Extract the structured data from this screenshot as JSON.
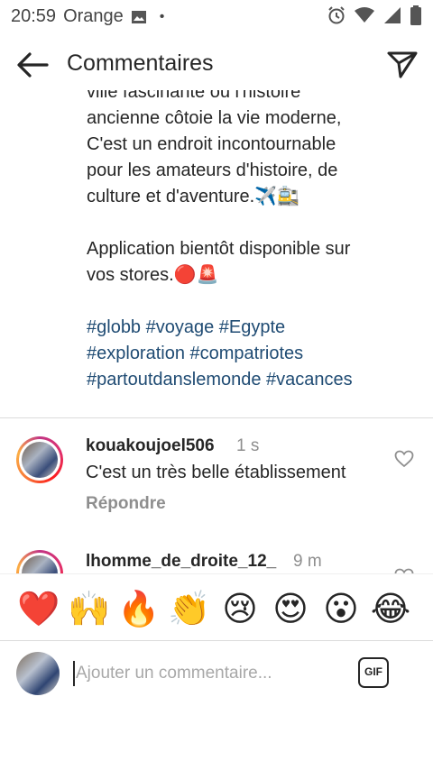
{
  "status_bar": {
    "time": "20:59",
    "carrier": "Orange",
    "dot": "•"
  },
  "header": {
    "title": "Commentaires"
  },
  "caption": {
    "lines": [
      "ville fascinante où l'histoire",
      "ancienne côtoie la vie moderne,",
      "C'est un endroit incontournable",
      "pour les amateurs d'histoire, de",
      "culture et d'aventure.✈️🚉",
      "",
      "Application bientôt disponible sur",
      "vos stores.🔴🚨",
      ""
    ],
    "hashtag_lines": [
      "#globb #voyage #Egypte",
      "#exploration #compatriotes",
      "#partoutdanslemonde #vacances"
    ]
  },
  "comments": [
    {
      "username": "kouakoujoel506",
      "time": "1 s",
      "text": "C'est un très belle établissement",
      "reply": "Répondre"
    },
    {
      "username": "lhomme_de_droite_12_",
      "time": "9 m"
    }
  ],
  "quick_reactions": [
    "❤️",
    "🙌",
    "🔥",
    "👏",
    "😢",
    "😍",
    "😮",
    "😂"
  ],
  "comment_input": {
    "placeholder": "Ajouter un commentaire...",
    "gif_label": "GIF"
  },
  "colors": {
    "hashtag": "#1f4b73",
    "secondary_text": "#8e8e8e",
    "primary_text": "#262626"
  }
}
